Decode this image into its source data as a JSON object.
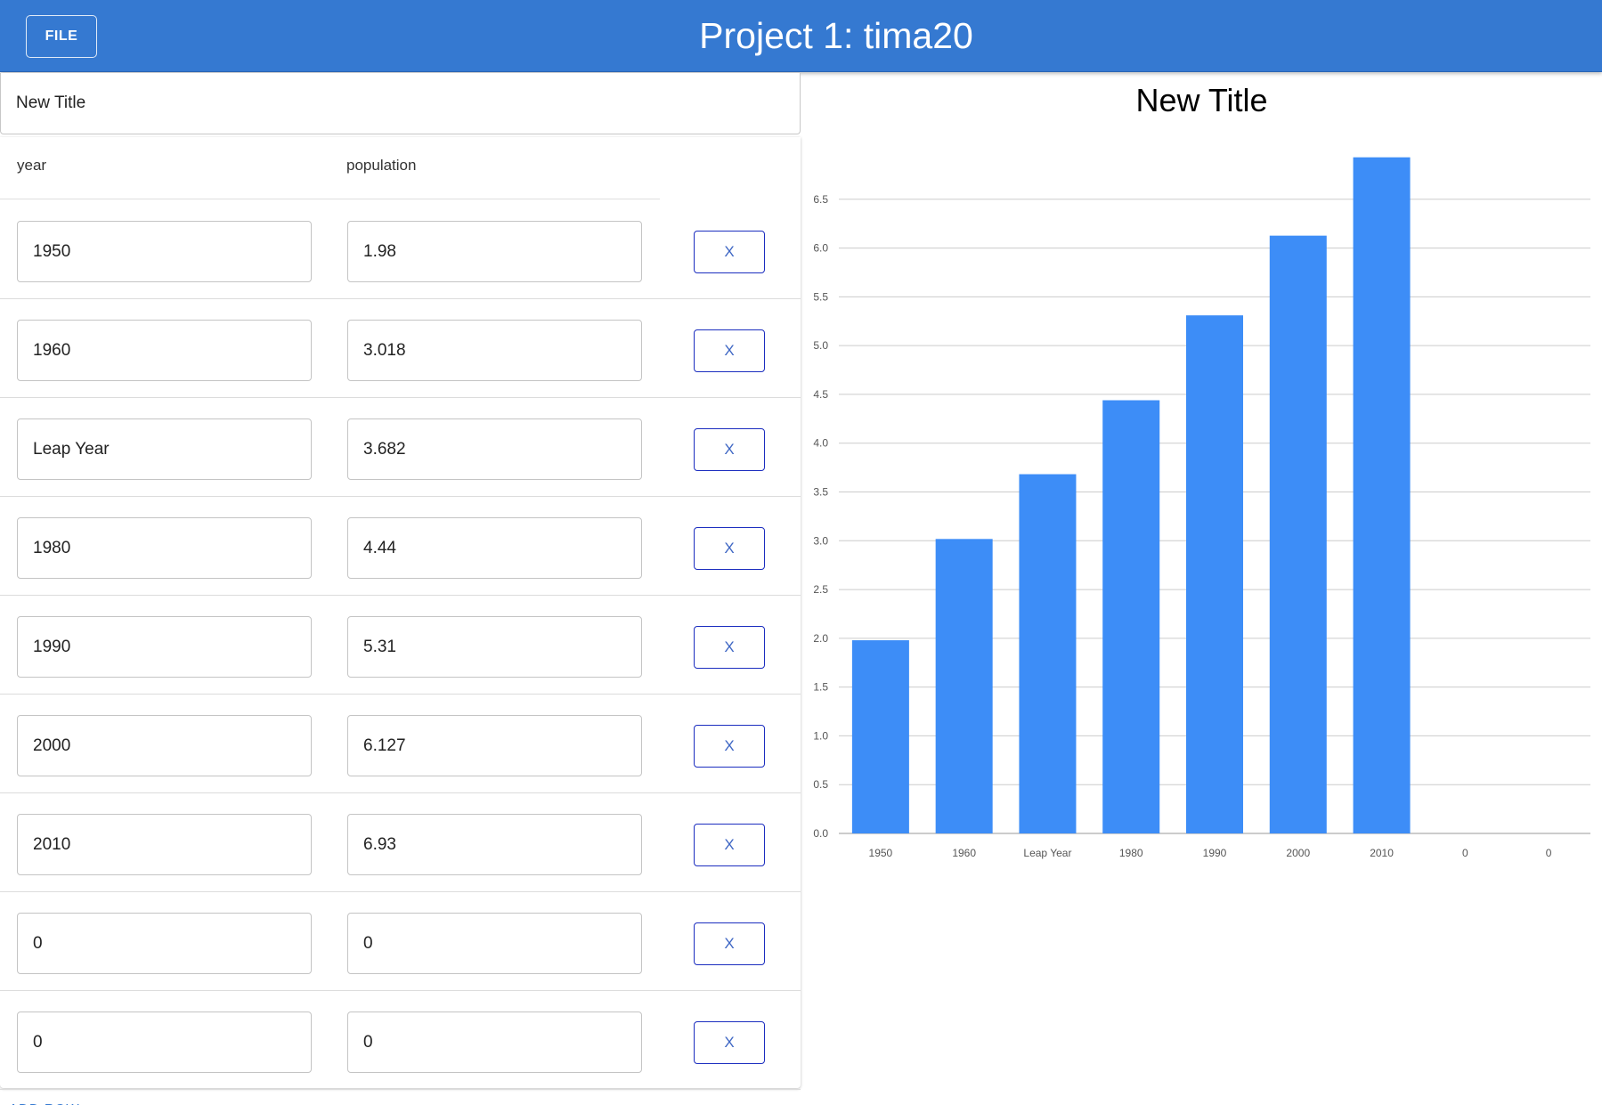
{
  "header": {
    "file_label": "FILE",
    "title": "Project 1: tima20",
    "color": "#3579d1"
  },
  "editor": {
    "title_value": "New Title",
    "columns": [
      "year",
      "population"
    ],
    "rows": [
      {
        "year": "1950",
        "population": "1.98"
      },
      {
        "year": "1960",
        "population": "3.018"
      },
      {
        "year": "Leap Year",
        "population": "3.682"
      },
      {
        "year": "1980",
        "population": "4.44"
      },
      {
        "year": "1990",
        "population": "5.31"
      },
      {
        "year": "2000",
        "population": "6.127"
      },
      {
        "year": "2010",
        "population": "6.93"
      },
      {
        "year": "0",
        "population": "0"
      },
      {
        "year": "0",
        "population": "0"
      }
    ],
    "delete_label": "X",
    "add_row_label": "ADD ROW"
  },
  "chart_data": {
    "type": "bar",
    "title": "New Title",
    "categories": [
      "1950",
      "1960",
      "Leap Year",
      "1980",
      "1990",
      "2000",
      "2010",
      "0",
      "0"
    ],
    "values": [
      1.98,
      3.018,
      3.682,
      4.44,
      5.31,
      6.127,
      6.93,
      0,
      0
    ],
    "ylim": [
      0,
      7
    ],
    "yticks": [
      0.0,
      0.5,
      1.0,
      1.5,
      2.0,
      2.5,
      3.0,
      3.5,
      4.0,
      4.5,
      5.0,
      5.5,
      6.0,
      6.5
    ],
    "ytick_labels": [
      "0.0",
      "0.5",
      "1.0",
      "1.5",
      "2.0",
      "2.5",
      "3.0",
      "3.5",
      "4.0",
      "4.5",
      "5.0",
      "5.5",
      "6.0",
      "6.5"
    ],
    "grid": true,
    "bar_color": "#3d8df7"
  }
}
